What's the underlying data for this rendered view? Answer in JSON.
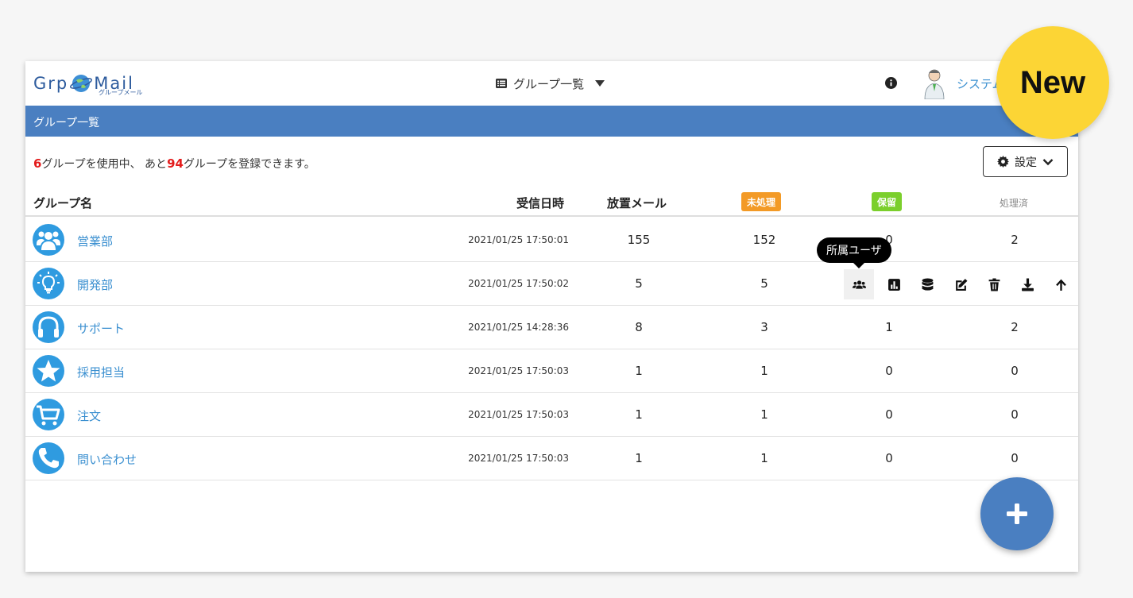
{
  "header": {
    "logo_left": "Grp",
    "logo_right": "Mail",
    "logo_sub": "グループメール",
    "nav_label": "グループ一覧",
    "user_name": "システム"
  },
  "titlebar": {
    "title": "グループ一覧"
  },
  "usage": {
    "used_count": "6",
    "used_text": "グループを使用中、 あと",
    "remaining_count": "94",
    "remaining_text": "グループを登録できます。"
  },
  "settings": {
    "label": "設定"
  },
  "table": {
    "headers": {
      "name": "グループ名",
      "received": "受信日時",
      "idle": "放置メール",
      "unprocessed": "未処理",
      "hold": "保留",
      "done": "処理済"
    },
    "badge_colors": {
      "unprocessed": "#f39a26",
      "hold": "#7bcf2c"
    },
    "rows": [
      {
        "icon": "people-icon",
        "name": "営業部",
        "date": "2021/01/25 17:50:01",
        "idle": "155",
        "unprocessed": "152",
        "hold": "0",
        "done": "2"
      },
      {
        "icon": "lightbulb-icon",
        "name": "開発部",
        "date": "2021/01/25 17:50:02",
        "idle": "5",
        "unprocessed": "5",
        "hold": "",
        "done": ""
      },
      {
        "icon": "headphones-icon",
        "name": "サポート",
        "date": "2021/01/25 14:28:36",
        "idle": "8",
        "unprocessed": "3",
        "hold": "1",
        "done": "2"
      },
      {
        "icon": "star-icon",
        "name": "採用担当",
        "date": "2021/01/25 17:50:03",
        "idle": "1",
        "unprocessed": "1",
        "hold": "0",
        "done": "0"
      },
      {
        "icon": "cart-icon",
        "name": "注文",
        "date": "2021/01/25 17:50:03",
        "idle": "1",
        "unprocessed": "1",
        "hold": "0",
        "done": "0"
      },
      {
        "icon": "phone-icon",
        "name": "問い合わせ",
        "date": "2021/01/25 17:50:03",
        "idle": "1",
        "unprocessed": "1",
        "hold": "0",
        "done": "0"
      }
    ]
  },
  "row_actions": [
    "users-icon",
    "chart-icon",
    "database-icon",
    "edit-icon",
    "trash-icon",
    "download-icon",
    "arrow-up-icon"
  ],
  "tooltip": {
    "text": "所属ユーザ"
  },
  "new_badge": {
    "text": "New"
  },
  "colors": {
    "accent": "#4a7fc1",
    "link": "#3a8fd0",
    "icon_bg": "#2f9be0",
    "highlight": "#e31c1c",
    "badge": "#fcd535"
  }
}
